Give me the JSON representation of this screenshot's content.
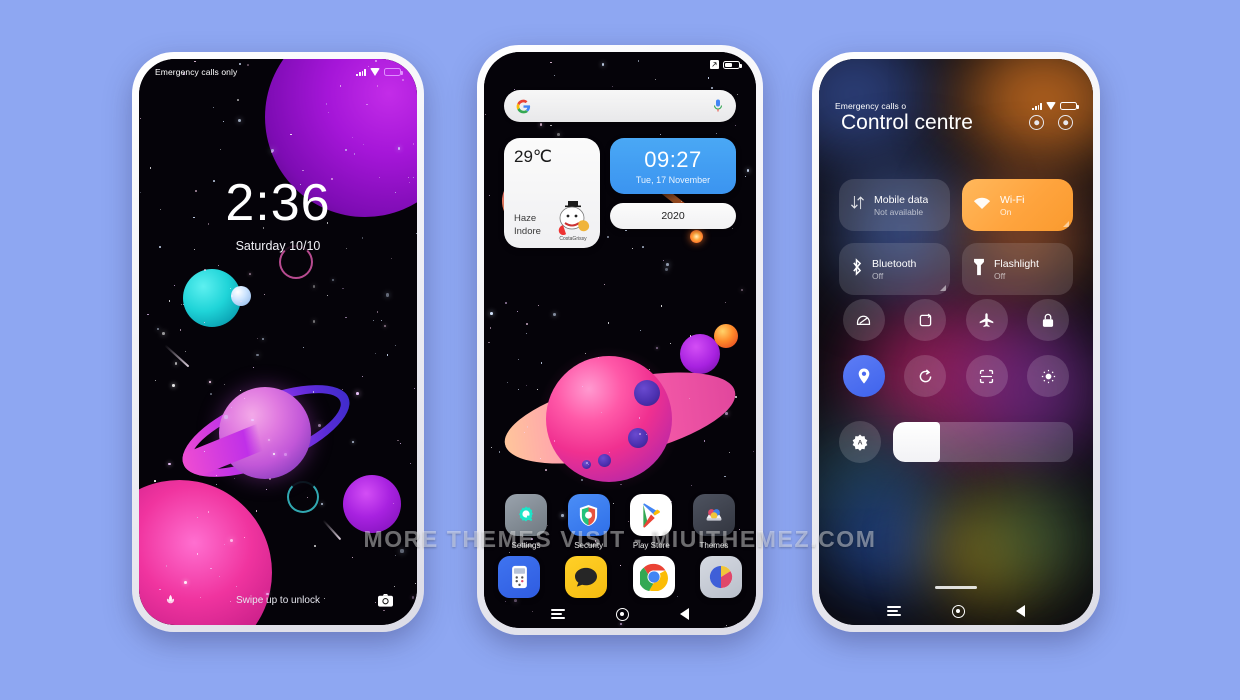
{
  "background_color": "#8ea7f2",
  "watermark": "MORE THEMES VISIT - MIUITHEMEZ.COM",
  "phone1": {
    "name": "lockscreen",
    "statusbar": {
      "carrier": "Emergency calls only",
      "signal_icon": "signal-bars-icon",
      "wifi_icon": "wifi-icon",
      "battery_icon": "battery-icon"
    },
    "clock": {
      "time": "2:36",
      "date": "Saturday 10/10"
    },
    "bottom": {
      "left_icon": "flower-shortcut-icon",
      "hint": "Swipe up to unlock",
      "right_icon": "camera-shortcut-icon"
    }
  },
  "phone2": {
    "name": "homescreen",
    "statusbar": {
      "carrier": "",
      "mute_icon": "mute-icon",
      "battery_icon": "battery-icon"
    },
    "search": {
      "logo_icon": "google-logo-icon",
      "mic_icon": "microphone-icon",
      "placeholder": ""
    },
    "weather_widget": {
      "temperature": "29℃",
      "condition": "Haze",
      "city": "Indore",
      "sticker_label": "CostaGrissy"
    },
    "clock_widget": {
      "time": "09:27",
      "date": "Tue, 17 November"
    },
    "year_widget": {
      "year": "2020"
    },
    "apps": [
      {
        "label": "Settings",
        "icon": "settings-gear-icon"
      },
      {
        "label": "Security",
        "icon": "security-shield-icon"
      },
      {
        "label": "Play Store",
        "icon": "play-store-icon"
      },
      {
        "label": "Themes",
        "icon": "themes-icon"
      }
    ],
    "dock": [
      {
        "label": "Phone",
        "icon": "phone-dialer-icon"
      },
      {
        "label": "Messages",
        "icon": "messages-icon"
      },
      {
        "label": "Chrome",
        "icon": "chrome-icon"
      },
      {
        "label": "Gallery",
        "icon": "gallery-icon"
      }
    ],
    "navbar": [
      {
        "label": "Recents",
        "icon": "recents-icon"
      },
      {
        "label": "Home",
        "icon": "home-icon"
      },
      {
        "label": "Back",
        "icon": "back-icon"
      }
    ]
  },
  "phone3": {
    "name": "control-centre",
    "statusbar": {
      "carrier": "Emergency calls o",
      "signal_icon": "signal-bars-icon",
      "wifi_icon": "wifi-icon",
      "battery_icon": "battery-icon"
    },
    "title": "Control centre",
    "header_icons": [
      {
        "name": "settings-ring-icon"
      },
      {
        "name": "power-ring-icon"
      }
    ],
    "big_tiles": [
      {
        "label": "Mobile data",
        "status": "Not available",
        "icon": "mobile-data-icon",
        "on": false
      },
      {
        "label": "Wi-Fi",
        "status": "On",
        "icon": "wifi-tile-icon",
        "on": true,
        "accent": "#ffa43e"
      },
      {
        "label": "Bluetooth",
        "status": "Off",
        "icon": "bluetooth-icon",
        "on": false
      },
      {
        "label": "Flashlight",
        "status": "Off",
        "icon": "flashlight-icon",
        "on": false
      }
    ],
    "toggles": [
      {
        "name": "do-not-disturb-icon",
        "active": false
      },
      {
        "name": "screen-rotation-icon",
        "active": false
      },
      {
        "name": "airplane-mode-icon",
        "active": false
      },
      {
        "name": "screen-lock-icon",
        "active": false
      },
      {
        "name": "location-icon",
        "active": true
      },
      {
        "name": "sync-icon",
        "active": false
      },
      {
        "name": "scan-qr-icon",
        "active": false
      },
      {
        "name": "dark-mode-icon",
        "active": false
      }
    ],
    "brightness": {
      "auto_icon": "auto-brightness-icon",
      "level_percent": 26
    },
    "navbar": [
      {
        "label": "Recents",
        "icon": "recents-icon"
      },
      {
        "label": "Home",
        "icon": "home-icon"
      },
      {
        "label": "Back",
        "icon": "back-icon"
      }
    ]
  }
}
